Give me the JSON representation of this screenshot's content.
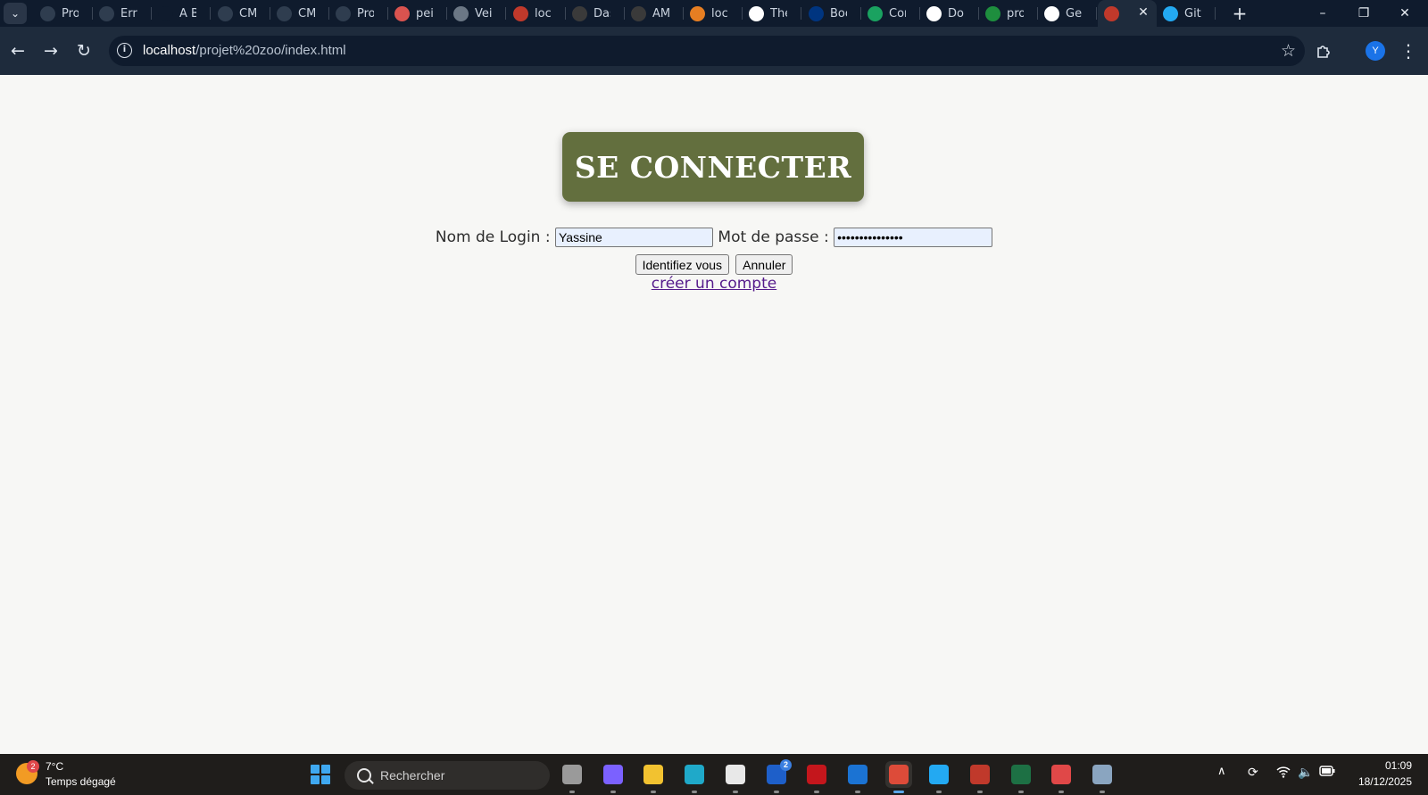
{
  "browser": {
    "tabs": [
      {
        "label": "Pro",
        "icon": "perplexity-icon",
        "color": "#2f3d4f"
      },
      {
        "label": "Erre",
        "icon": "openai-icon",
        "color": "#2f3d4f"
      },
      {
        "label": "A B",
        "icon": "font-f-icon",
        "color": "#0f1b2d"
      },
      {
        "label": "CM",
        "icon": "loading-spinner-icon",
        "color": "#2f3d4f"
      },
      {
        "label": "CM",
        "icon": "loading-spinner-icon",
        "color": "#2f3d4f"
      },
      {
        "label": "Pro",
        "icon": "perplexity-icon",
        "color": "#2f3d4f"
      },
      {
        "label": "pei",
        "icon": "red-badge-icon",
        "color": "#d9534f"
      },
      {
        "label": "Vei",
        "icon": "globe-icon",
        "color": "#6b7785"
      },
      {
        "label": "loc",
        "icon": "colorful-swirl-icon",
        "color": "#c0392b"
      },
      {
        "label": "Das",
        "icon": "dark-swirl-icon",
        "color": "#3a3a3a"
      },
      {
        "label": "AM",
        "icon": "dark-swirl-icon",
        "color": "#3a3a3a"
      },
      {
        "label": "loc",
        "icon": "xampp-icon",
        "color": "#e67e22"
      },
      {
        "label": "The",
        "icon": "google-icon",
        "color": "#ffffff"
      },
      {
        "label": "Boo",
        "icon": "booking-icon",
        "color": "#003580"
      },
      {
        "label": "Cor",
        "icon": "green-app-icon",
        "color": "#1aa260"
      },
      {
        "label": "Do",
        "icon": "gmail-icon",
        "color": "#ffffff"
      },
      {
        "label": "pro",
        "icon": "google-drive-icon",
        "color": "#1e8e3e"
      },
      {
        "label": "Ge",
        "icon": "github-icon",
        "color": "#ffffff"
      },
      {
        "label": "",
        "icon": "colorful-swirl-icon",
        "color": "#c0392b",
        "active": true
      },
      {
        "label": "Git",
        "icon": "vscode-icon",
        "color": "#23a9f2"
      }
    ],
    "new_tab": "+",
    "window_controls": {
      "minimize": "–",
      "restore": "❐",
      "close": "✕"
    },
    "url": {
      "host": "localhost",
      "path": "/projet%20zoo/index.html"
    },
    "profile_initial": "Y"
  },
  "page": {
    "title": "SE CONNECTER",
    "login_label": "Nom de Login :",
    "login_value": "Yassine",
    "password_label": "Mot de passe :",
    "password_value": "•••••••••••••••",
    "submit_button": "Identifiez vous",
    "cancel_button": "Annuler",
    "create_account_link": "créer un compte"
  },
  "taskbar": {
    "weather": {
      "badge": "2",
      "temperature": "7°C",
      "description": "Temps dégagé"
    },
    "search_placeholder": "Rechercher",
    "apps": [
      {
        "name": "task-view",
        "color": "#9a9a9a"
      },
      {
        "name": "copilot",
        "color": "#7b61ff"
      },
      {
        "name": "file-explorer",
        "color": "#f2c230"
      },
      {
        "name": "edge",
        "color": "#1fa9c9"
      },
      {
        "name": "microsoft-store",
        "color": "#e8e8e8"
      },
      {
        "name": "learning-app",
        "color": "#1e5fc9",
        "badge": "2"
      },
      {
        "name": "mcafee",
        "color": "#c4161c"
      },
      {
        "name": "outlook",
        "color": "#1b73d3"
      },
      {
        "name": "chrome",
        "color": "#dd4b39",
        "active": true
      },
      {
        "name": "vscode",
        "color": "#23a9f2"
      },
      {
        "name": "colorful-swirl-app",
        "color": "#c0392b"
      },
      {
        "name": "excel",
        "color": "#1d7044"
      },
      {
        "name": "snipping-tool",
        "color": "#e04848"
      },
      {
        "name": "settings",
        "color": "#8aa5c0"
      }
    ],
    "clock_time": "01:09",
    "clock_date": "18/12/2025"
  }
}
